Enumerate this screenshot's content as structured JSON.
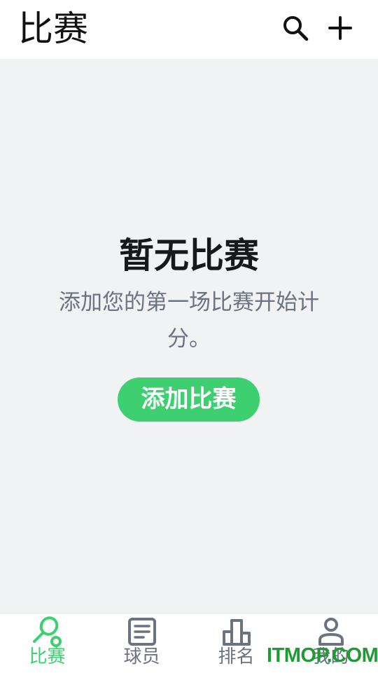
{
  "header": {
    "title": "比赛",
    "search_icon": "search-icon",
    "add_icon": "plus-icon"
  },
  "empty_state": {
    "title": "暂无比赛",
    "description": "添加您的第一场比赛开始计分。",
    "button_label": "添加比赛"
  },
  "tabs": [
    {
      "label": "比赛",
      "icon": "racket-icon",
      "active": true
    },
    {
      "label": "球员",
      "icon": "list-icon",
      "active": false
    },
    {
      "label": "排名",
      "icon": "podium-icon",
      "active": false
    },
    {
      "label": "我的",
      "icon": "person-icon",
      "active": false
    }
  ],
  "watermark": "ITMOP.COM",
  "colors": {
    "accent": "#3ecf70",
    "inactive": "#6b7280",
    "background": "#f1f2f4",
    "watermark": "#1e9b33"
  }
}
